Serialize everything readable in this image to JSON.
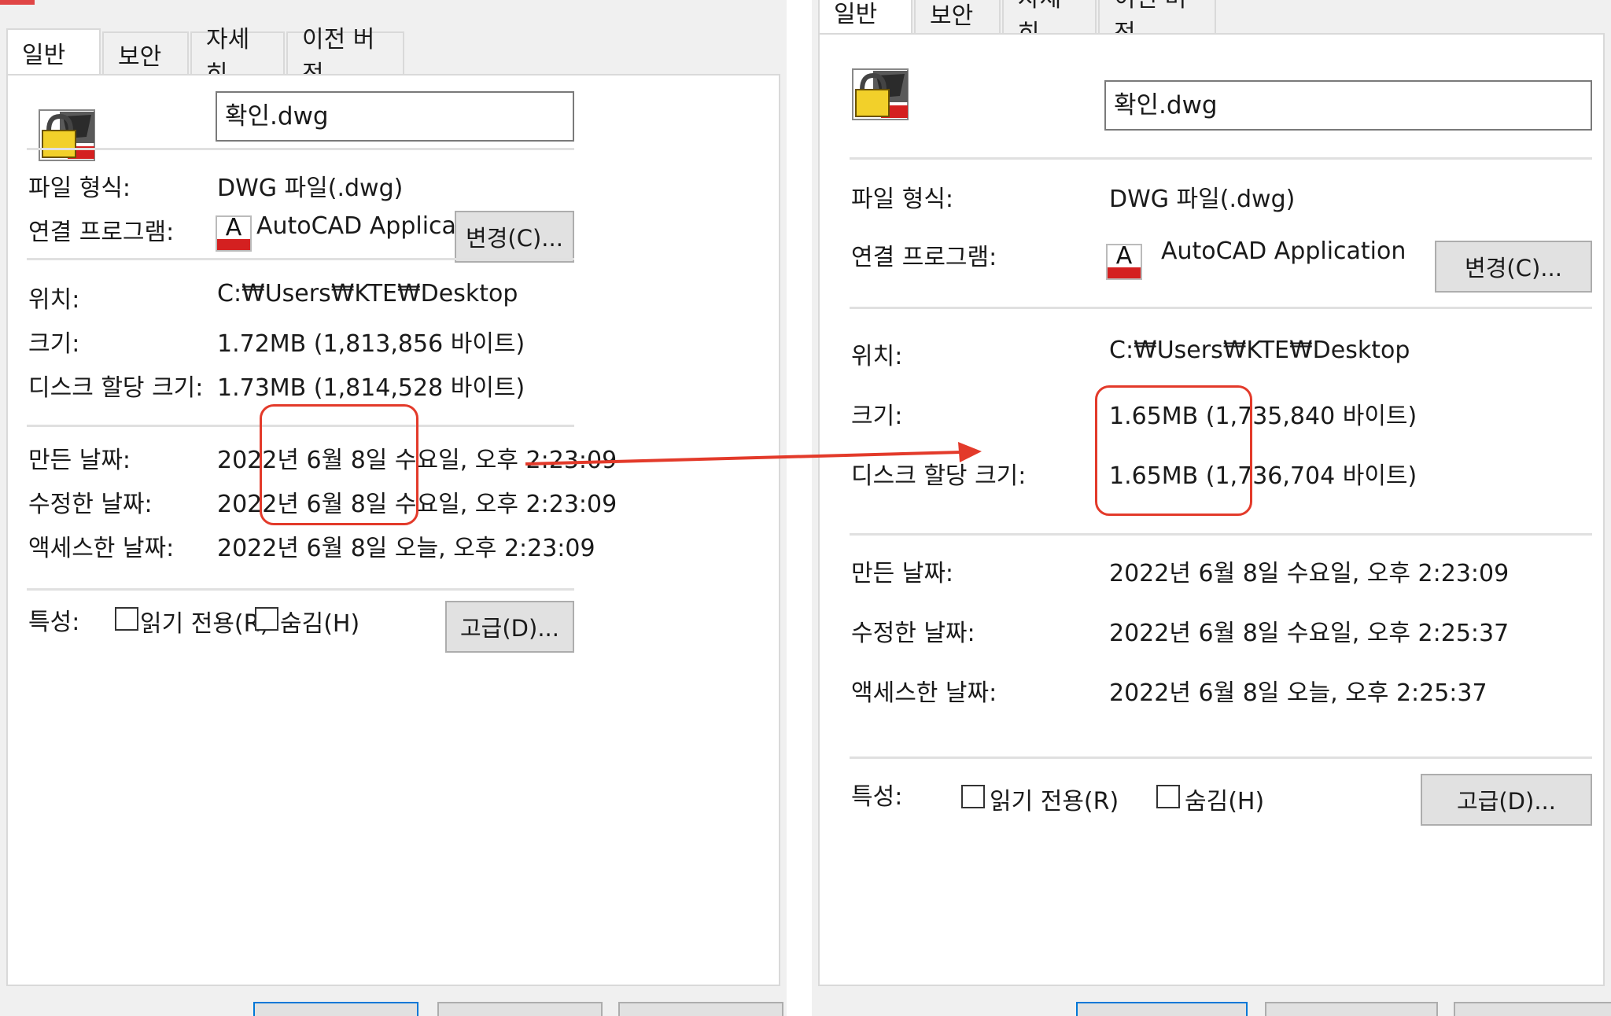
{
  "tabs": [
    "일반",
    "보안",
    "자세히",
    "이전 버전"
  ],
  "labels": {
    "file_type": "파일 형식:",
    "opens_with": "연결 프로그램:",
    "location": "위치:",
    "size": "크기:",
    "size_on_disk": "디스크 할당 크기:",
    "created": "만든 날짜:",
    "modified": "수정한 날짜:",
    "accessed": "액세스한 날짜:",
    "attributes": "특성:"
  },
  "buttons": {
    "change": "변경(C)...",
    "advanced": "고급(D)..."
  },
  "checkboxes": {
    "readonly": "읽기 전용(R)",
    "hidden": "숨김(H)"
  },
  "app_icon_letter": "A",
  "colors": {
    "highlight": "#e33a2a",
    "arrow": "#e33a2a"
  },
  "left": {
    "filename": "확인.dwg",
    "file_type": "DWG 파일(.dwg)",
    "app": "AutoCAD Application",
    "location": "C:₩Users₩KTE₩Desktop",
    "size": "1.72MB (1,813,856 바이트)",
    "size_on_disk": "1.73MB (1,814,528 바이트)",
    "created": "2022년 6월 8일 수요일, 오후 2:23:09",
    "modified": "2022년 6월 8일 수요일, 오후 2:23:09",
    "accessed": "2022년 6월 8일 오늘, 오후 2:23:09"
  },
  "right": {
    "filename": "확인.dwg",
    "file_type": "DWG 파일(.dwg)",
    "app": "AutoCAD Application",
    "location": "C:₩Users₩KTE₩Desktop",
    "size": "1.65MB (1,735,840 바이트)",
    "size_on_disk": "1.65MB (1,736,704 바이트)",
    "created": "2022년 6월 8일 수요일, 오후 2:23:09",
    "modified": "2022년 6월 8일 수요일, 오후 2:25:37",
    "accessed": "2022년 6월 8일 오늘, 오후 2:25:37"
  }
}
